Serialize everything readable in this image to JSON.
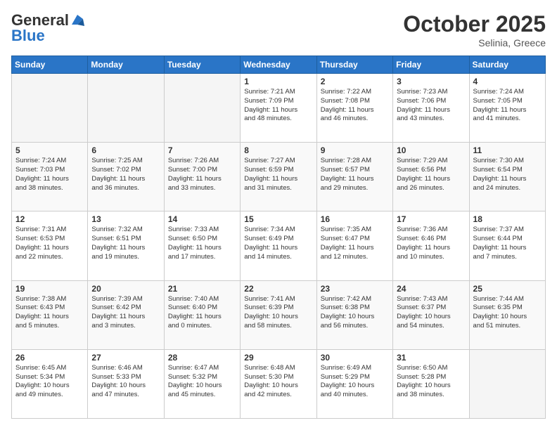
{
  "header": {
    "logo_line1": "General",
    "logo_line2": "Blue",
    "month": "October 2025",
    "location": "Selinia, Greece"
  },
  "days_of_week": [
    "Sunday",
    "Monday",
    "Tuesday",
    "Wednesday",
    "Thursday",
    "Friday",
    "Saturday"
  ],
  "weeks": [
    [
      {
        "num": "",
        "info": ""
      },
      {
        "num": "",
        "info": ""
      },
      {
        "num": "",
        "info": ""
      },
      {
        "num": "1",
        "info": "Sunrise: 7:21 AM\nSunset: 7:09 PM\nDaylight: 11 hours\nand 48 minutes."
      },
      {
        "num": "2",
        "info": "Sunrise: 7:22 AM\nSunset: 7:08 PM\nDaylight: 11 hours\nand 46 minutes."
      },
      {
        "num": "3",
        "info": "Sunrise: 7:23 AM\nSunset: 7:06 PM\nDaylight: 11 hours\nand 43 minutes."
      },
      {
        "num": "4",
        "info": "Sunrise: 7:24 AM\nSunset: 7:05 PM\nDaylight: 11 hours\nand 41 minutes."
      }
    ],
    [
      {
        "num": "5",
        "info": "Sunrise: 7:24 AM\nSunset: 7:03 PM\nDaylight: 11 hours\nand 38 minutes."
      },
      {
        "num": "6",
        "info": "Sunrise: 7:25 AM\nSunset: 7:02 PM\nDaylight: 11 hours\nand 36 minutes."
      },
      {
        "num": "7",
        "info": "Sunrise: 7:26 AM\nSunset: 7:00 PM\nDaylight: 11 hours\nand 33 minutes."
      },
      {
        "num": "8",
        "info": "Sunrise: 7:27 AM\nSunset: 6:59 PM\nDaylight: 11 hours\nand 31 minutes."
      },
      {
        "num": "9",
        "info": "Sunrise: 7:28 AM\nSunset: 6:57 PM\nDaylight: 11 hours\nand 29 minutes."
      },
      {
        "num": "10",
        "info": "Sunrise: 7:29 AM\nSunset: 6:56 PM\nDaylight: 11 hours\nand 26 minutes."
      },
      {
        "num": "11",
        "info": "Sunrise: 7:30 AM\nSunset: 6:54 PM\nDaylight: 11 hours\nand 24 minutes."
      }
    ],
    [
      {
        "num": "12",
        "info": "Sunrise: 7:31 AM\nSunset: 6:53 PM\nDaylight: 11 hours\nand 22 minutes."
      },
      {
        "num": "13",
        "info": "Sunrise: 7:32 AM\nSunset: 6:51 PM\nDaylight: 11 hours\nand 19 minutes."
      },
      {
        "num": "14",
        "info": "Sunrise: 7:33 AM\nSunset: 6:50 PM\nDaylight: 11 hours\nand 17 minutes."
      },
      {
        "num": "15",
        "info": "Sunrise: 7:34 AM\nSunset: 6:49 PM\nDaylight: 11 hours\nand 14 minutes."
      },
      {
        "num": "16",
        "info": "Sunrise: 7:35 AM\nSunset: 6:47 PM\nDaylight: 11 hours\nand 12 minutes."
      },
      {
        "num": "17",
        "info": "Sunrise: 7:36 AM\nSunset: 6:46 PM\nDaylight: 11 hours\nand 10 minutes."
      },
      {
        "num": "18",
        "info": "Sunrise: 7:37 AM\nSunset: 6:44 PM\nDaylight: 11 hours\nand 7 minutes."
      }
    ],
    [
      {
        "num": "19",
        "info": "Sunrise: 7:38 AM\nSunset: 6:43 PM\nDaylight: 11 hours\nand 5 minutes."
      },
      {
        "num": "20",
        "info": "Sunrise: 7:39 AM\nSunset: 6:42 PM\nDaylight: 11 hours\nand 3 minutes."
      },
      {
        "num": "21",
        "info": "Sunrise: 7:40 AM\nSunset: 6:40 PM\nDaylight: 11 hours\nand 0 minutes."
      },
      {
        "num": "22",
        "info": "Sunrise: 7:41 AM\nSunset: 6:39 PM\nDaylight: 10 hours\nand 58 minutes."
      },
      {
        "num": "23",
        "info": "Sunrise: 7:42 AM\nSunset: 6:38 PM\nDaylight: 10 hours\nand 56 minutes."
      },
      {
        "num": "24",
        "info": "Sunrise: 7:43 AM\nSunset: 6:37 PM\nDaylight: 10 hours\nand 54 minutes."
      },
      {
        "num": "25",
        "info": "Sunrise: 7:44 AM\nSunset: 6:35 PM\nDaylight: 10 hours\nand 51 minutes."
      }
    ],
    [
      {
        "num": "26",
        "info": "Sunrise: 6:45 AM\nSunset: 5:34 PM\nDaylight: 10 hours\nand 49 minutes."
      },
      {
        "num": "27",
        "info": "Sunrise: 6:46 AM\nSunset: 5:33 PM\nDaylight: 10 hours\nand 47 minutes."
      },
      {
        "num": "28",
        "info": "Sunrise: 6:47 AM\nSunset: 5:32 PM\nDaylight: 10 hours\nand 45 minutes."
      },
      {
        "num": "29",
        "info": "Sunrise: 6:48 AM\nSunset: 5:30 PM\nDaylight: 10 hours\nand 42 minutes."
      },
      {
        "num": "30",
        "info": "Sunrise: 6:49 AM\nSunset: 5:29 PM\nDaylight: 10 hours\nand 40 minutes."
      },
      {
        "num": "31",
        "info": "Sunrise: 6:50 AM\nSunset: 5:28 PM\nDaylight: 10 hours\nand 38 minutes."
      },
      {
        "num": "",
        "info": ""
      }
    ]
  ]
}
